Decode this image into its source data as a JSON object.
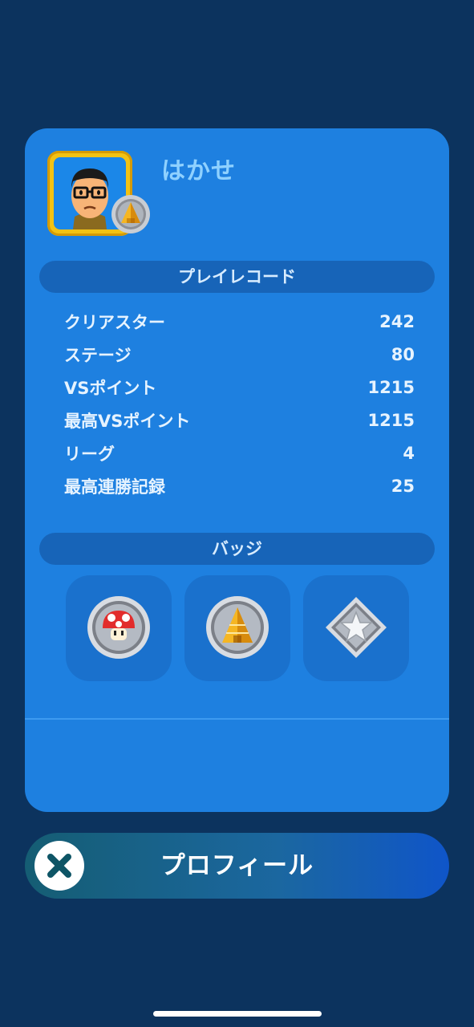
{
  "profile": {
    "name": "はかせ",
    "avatar_icon": "mii-glasses-avatar",
    "rank_badge_icon": "pyramid-badge-icon"
  },
  "play_record": {
    "header": "プレイレコード",
    "rows": [
      {
        "label": "クリアスター",
        "value": "242"
      },
      {
        "label": "ステージ",
        "value": "80"
      },
      {
        "label": "VSポイント",
        "value": "1215"
      },
      {
        "label": "最高VSポイント",
        "value": "1215"
      },
      {
        "label": "リーグ",
        "value": "4"
      },
      {
        "label": "最高連勝記録",
        "value": "25"
      }
    ]
  },
  "badges": {
    "header": "バッジ",
    "items": [
      {
        "icon": "mushroom-badge-icon"
      },
      {
        "icon": "pyramid-badge-icon"
      },
      {
        "icon": "star-badge-icon"
      }
    ]
  },
  "footer": {
    "button_label": "プロフィール",
    "close_icon": "close-icon"
  },
  "colors": {
    "background": "#0c335e",
    "card": "#1e80e0",
    "pill": "#1764b8",
    "name": "#8fd1ff",
    "frame": "#f2c213"
  }
}
